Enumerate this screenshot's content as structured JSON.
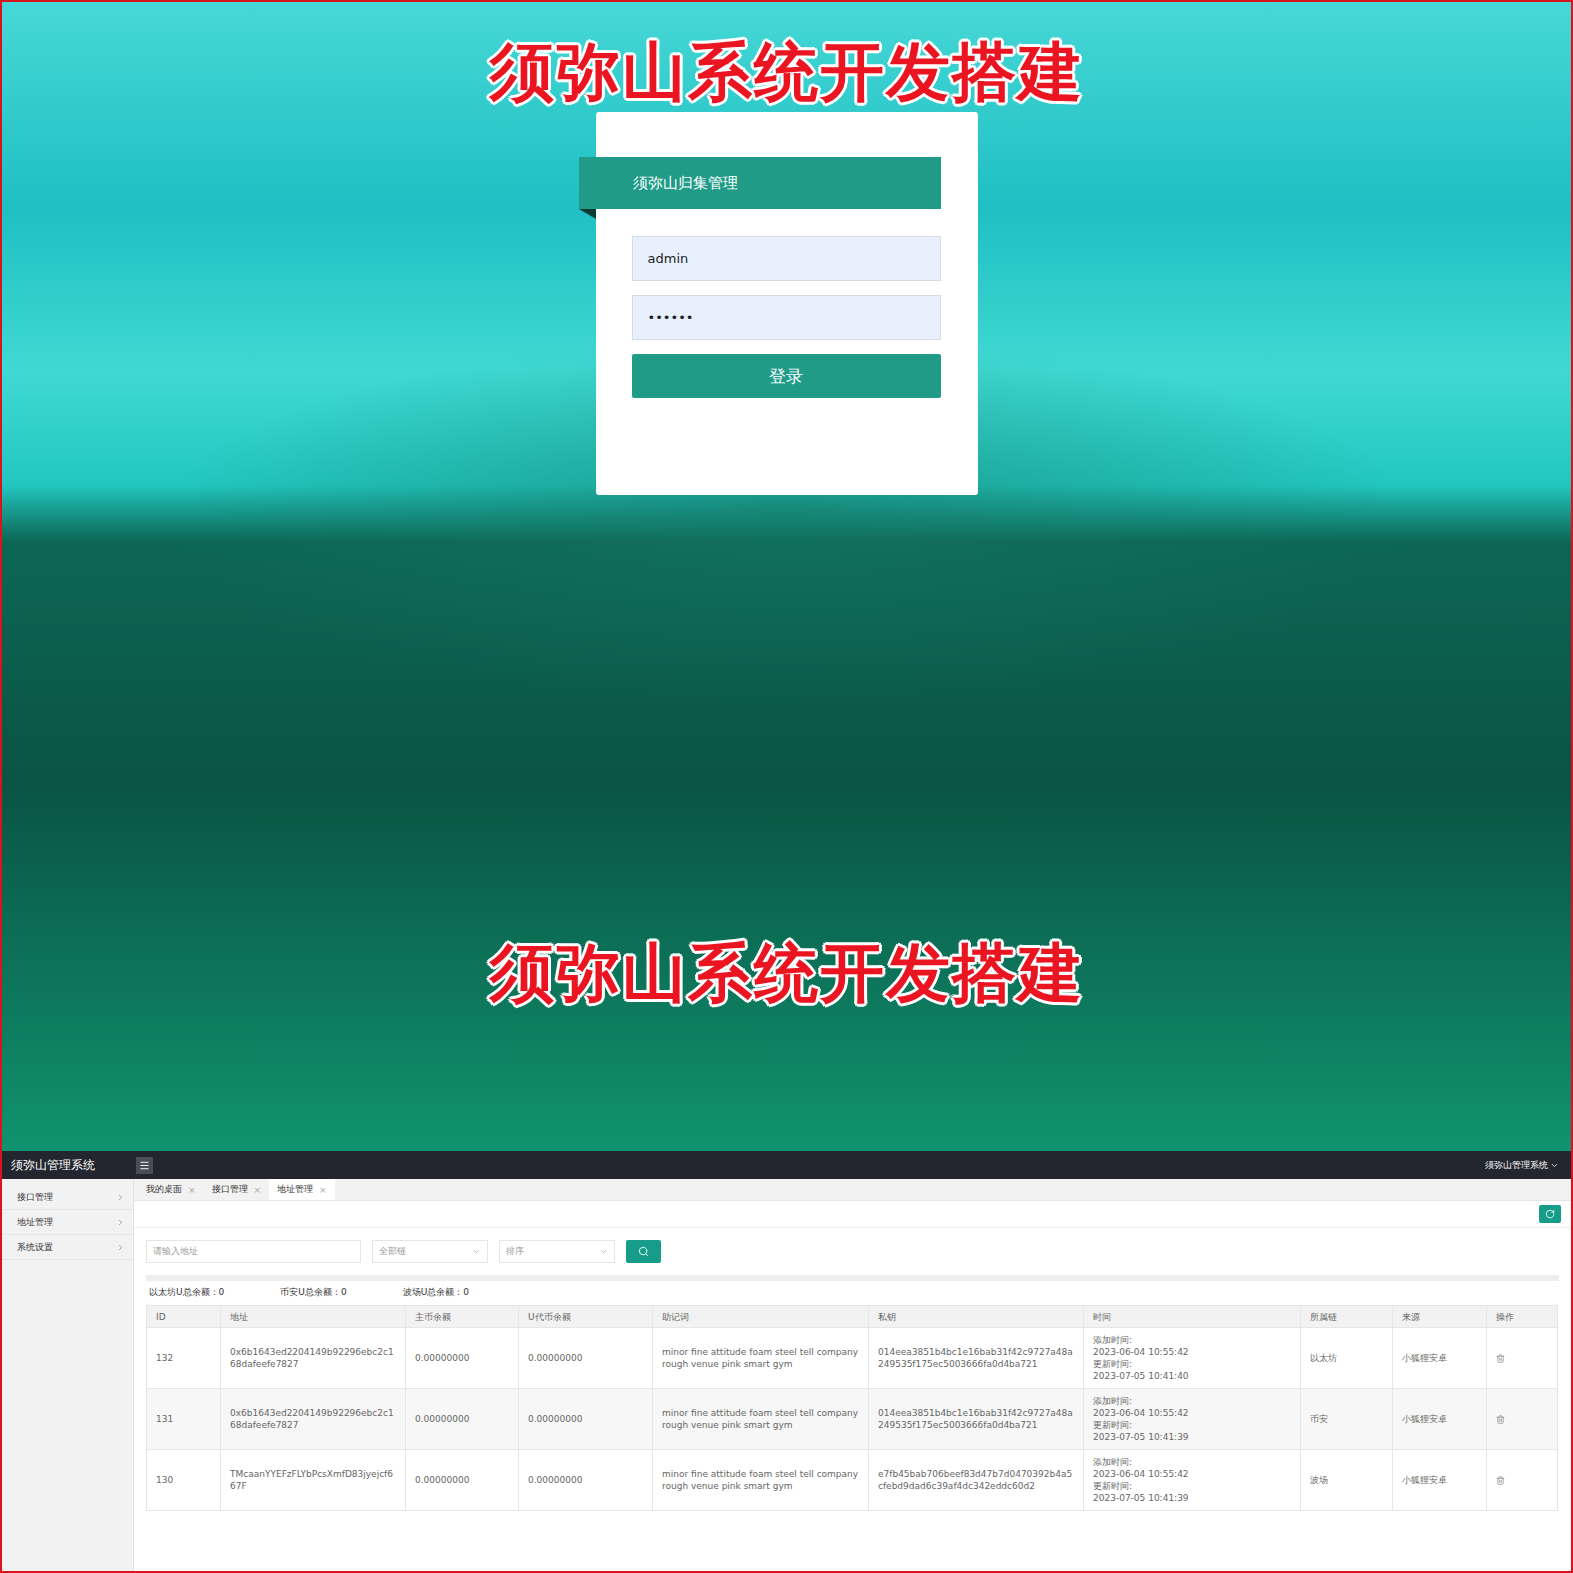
{
  "banners": [
    "须弥山系统开发搭建",
    "须弥山系统开发搭建"
  ],
  "login": {
    "title": "须弥山归集管理",
    "username": "admin",
    "password": "••••••",
    "button": "登录"
  },
  "topbar": {
    "title": "须弥山管理系统",
    "user": "须弥山管理系统"
  },
  "sidebar": {
    "items": [
      {
        "label": "接口管理",
        "expanded": false
      },
      {
        "label": "地址管理",
        "expanded": false
      },
      {
        "label": "系统设置",
        "expanded": false
      }
    ]
  },
  "tabs": [
    {
      "label": "我的桌面",
      "close": "×",
      "selected": false
    },
    {
      "label": "接口管理",
      "close": "×",
      "selected": false
    },
    {
      "label": "地址管理",
      "close": "×",
      "selected": true
    }
  ],
  "filters": {
    "address_placeholder": "请输入地址",
    "chain_select": "全部链",
    "sort_select": "排序"
  },
  "totals": [
    "以太坊U总余额：0",
    "币安U总余额：0",
    "波场U总余额：0"
  ],
  "table": {
    "columns": [
      "ID",
      "地址",
      "主币余额",
      "U代币余额",
      "助记词",
      "私钥",
      "时间",
      "所属链",
      "来源",
      "操作"
    ],
    "rows": [
      {
        "id": "132",
        "address": "0x6b1643ed2204149b92296ebc2c168dafeefe7827",
        "main_balance": "0.00000000",
        "token_balance": "0.00000000",
        "mnemonic": "minor fine attitude foam steel tell company rough venue pink smart gym",
        "private_key": "014eea3851b4bc1e16bab31f42c9727a48a249535f175ec5003666fa0d4ba721",
        "time": [
          "添加时间:",
          "2023-06-04 10:55:42",
          "更新时间:",
          "2023-07-05 10:41:40"
        ],
        "chain": "以太坊",
        "source": "小狐狸安卓",
        "selected": false
      },
      {
        "id": "131",
        "address": "0x6b1643ed2204149b92296ebc2c168dafeefe7827",
        "main_balance": "0.00000000",
        "token_balance": "0.00000000",
        "mnemonic": "minor fine attitude foam steel tell company rough venue pink smart gym",
        "private_key": "014eea3851b4bc1e16bab31f42c9727a48a249535f175ec5003666fa0d4ba721",
        "time": [
          "添加时间:",
          "2023-06-04 10:55:42",
          "更新时间:",
          "2023-07-05 10:41:39"
        ],
        "chain": "币安",
        "source": "小狐狸安卓",
        "selected": true
      },
      {
        "id": "130",
        "address": "TMcaanYYEFzFLYbPcsXmfD83jyejcf667F",
        "main_balance": "0.00000000",
        "token_balance": "0.00000000",
        "mnemonic": "minor fine attitude foam steel tell company rough venue pink smart gym",
        "private_key": "e7fb45bab706beef83d47b7d0470392b4a5cfebd9dad6c39af4dc342eddc60d2",
        "time": [
          "添加时间:",
          "2023-06-04 10:55:42",
          "更新时间:",
          "2023-07-05 10:41:39"
        ],
        "chain": "波场",
        "source": "小狐狸安卓",
        "selected": false
      }
    ]
  }
}
